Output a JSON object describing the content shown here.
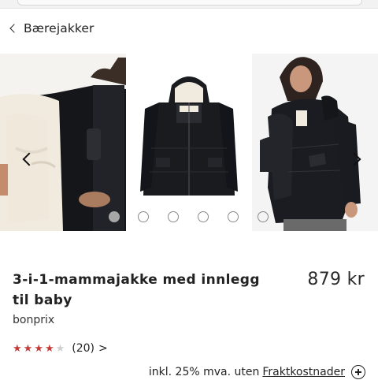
{
  "nav": {
    "back_label": "Bærejakker"
  },
  "gallery": {
    "images": [
      {
        "alt": "lining-view",
        "active": true
      },
      {
        "alt": "product-front",
        "active": false
      },
      {
        "alt": "model-wearing",
        "active": false
      }
    ],
    "dot_count": 6,
    "active_dot": 0
  },
  "product": {
    "title_line1": "3-i-1-mammajakke med innlegg",
    "title_line2": "til baby",
    "brand": "bonprix",
    "price": "879 kr",
    "rating": {
      "stars": 4,
      "max": 5,
      "count": "(20)",
      "more": ">"
    },
    "vat_text": "inkl. 25% mva. uten",
    "shipping_link": "Fraktkostnader"
  },
  "colors": {
    "star_active": "#c63a36",
    "star_inactive": "#cfcfcf",
    "jacket": "#15161a",
    "lining": "#f1ebdf"
  }
}
